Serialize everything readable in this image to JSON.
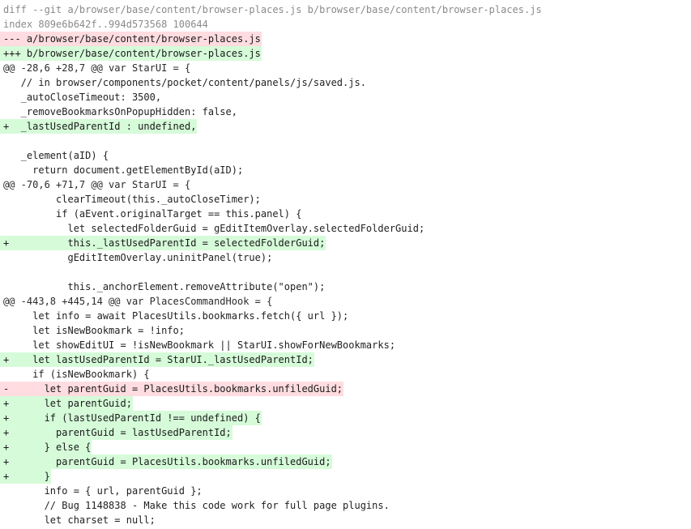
{
  "diff": {
    "lines": [
      {
        "type": "meta",
        "text": "diff --git a/browser/base/content/browser-places.js b/browser/base/content/browser-places.js"
      },
      {
        "type": "meta",
        "text": "index 809e6b642f..994d573568 100644"
      },
      {
        "type": "file-old",
        "text": "--- a/browser/base/content/browser-places.js"
      },
      {
        "type": "file-new",
        "text": "+++ b/browser/base/content/browser-places.js"
      },
      {
        "type": "hunk",
        "text": "@@ -28,6 +28,7 @@ var StarUI = {"
      },
      {
        "type": "ctx",
        "text": "   // in browser/components/pocket/content/panels/js/saved.js."
      },
      {
        "type": "ctx",
        "text": "   _autoCloseTimeout: 3500,"
      },
      {
        "type": "ctx",
        "text": "   _removeBookmarksOnPopupHidden: false,"
      },
      {
        "type": "add",
        "text": "+  _lastUsedParentId : undefined,"
      },
      {
        "type": "ctx",
        "text": " "
      },
      {
        "type": "ctx",
        "text": "   _element(aID) {"
      },
      {
        "type": "ctx",
        "text": "     return document.getElementById(aID);"
      },
      {
        "type": "hunk",
        "text": "@@ -70,6 +71,7 @@ var StarUI = {"
      },
      {
        "type": "ctx",
        "text": "         clearTimeout(this._autoCloseTimer);"
      },
      {
        "type": "ctx",
        "text": "         if (aEvent.originalTarget == this.panel) {"
      },
      {
        "type": "ctx",
        "text": "           let selectedFolderGuid = gEditItemOverlay.selectedFolderGuid;"
      },
      {
        "type": "add",
        "text": "+          this._lastUsedParentId = selectedFolderGuid;"
      },
      {
        "type": "ctx",
        "text": "           gEditItemOverlay.uninitPanel(true);"
      },
      {
        "type": "ctx",
        "text": " "
      },
      {
        "type": "ctx",
        "text": "           this._anchorElement.removeAttribute(\"open\");"
      },
      {
        "type": "hunk",
        "text": "@@ -443,8 +445,14 @@ var PlacesCommandHook = {"
      },
      {
        "type": "ctx",
        "text": "     let info = await PlacesUtils.bookmarks.fetch({ url });"
      },
      {
        "type": "ctx",
        "text": "     let isNewBookmark = !info;"
      },
      {
        "type": "ctx",
        "text": "     let showEditUI = !isNewBookmark || StarUI.showForNewBookmarks;"
      },
      {
        "type": "add",
        "text": "+    let lastUsedParentId = StarUI._lastUsedParentId;"
      },
      {
        "type": "ctx",
        "text": "     if (isNewBookmark) {"
      },
      {
        "type": "del",
        "text": "-      let parentGuid = PlacesUtils.bookmarks.unfiledGuid;"
      },
      {
        "type": "add",
        "text": "+      let parentGuid;"
      },
      {
        "type": "add",
        "text": "+      if (lastUsedParentId !== undefined) {"
      },
      {
        "type": "add",
        "text": "+        parentGuid = lastUsedParentId;"
      },
      {
        "type": "add",
        "text": "+      } else {"
      },
      {
        "type": "add",
        "text": "+        parentGuid = PlacesUtils.bookmarks.unfiledGuid;"
      },
      {
        "type": "add",
        "text": "+      }"
      },
      {
        "type": "ctx",
        "text": "       info = { url, parentGuid };"
      },
      {
        "type": "ctx",
        "text": "       // Bug 1148838 - Make this code work for full page plugins."
      },
      {
        "type": "ctx",
        "text": "       let charset = null;"
      }
    ]
  }
}
